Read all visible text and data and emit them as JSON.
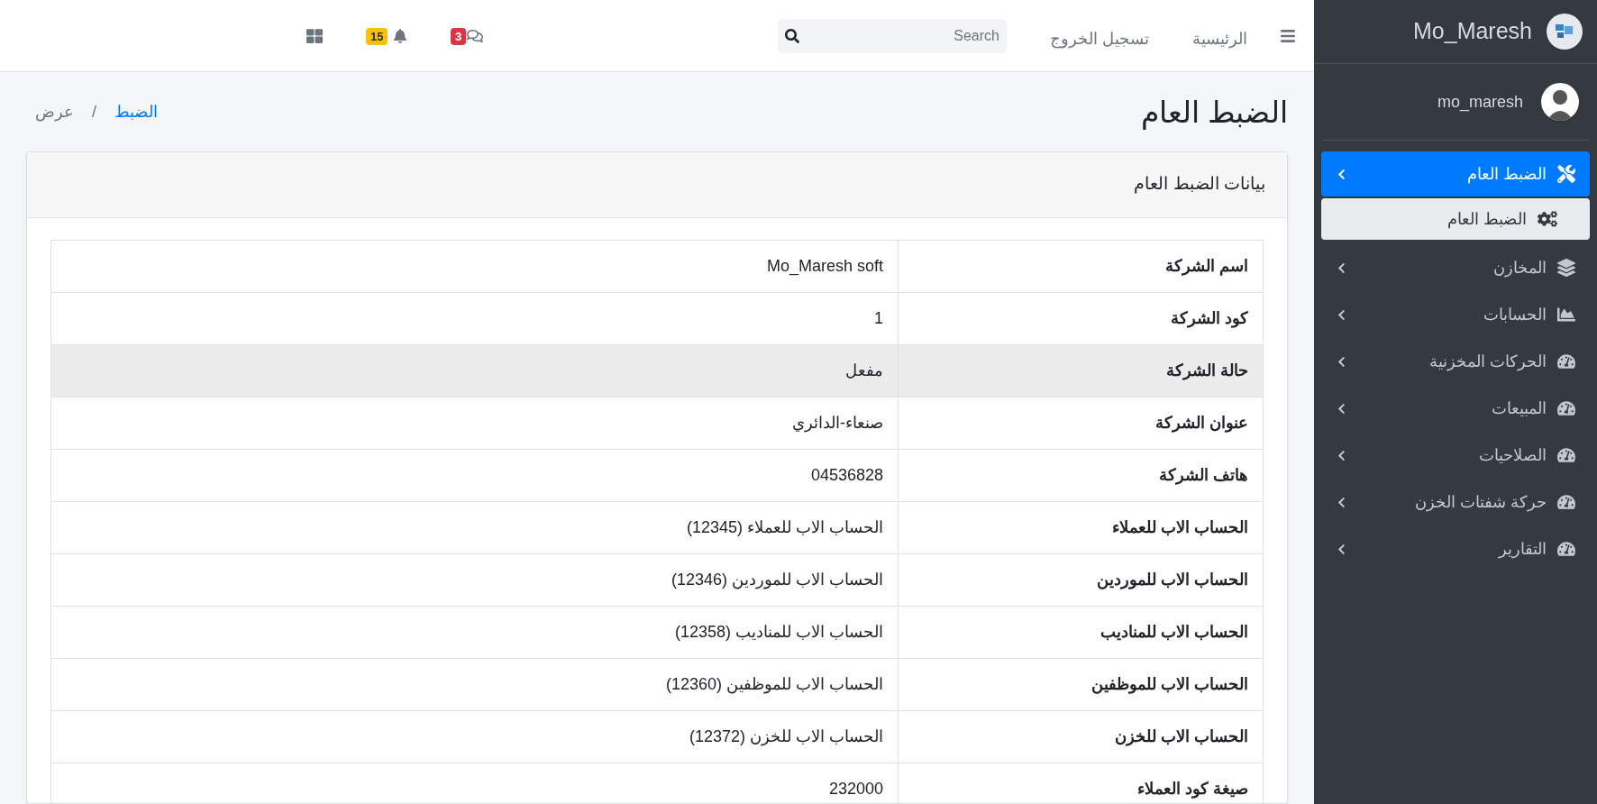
{
  "sidebar": {
    "brand": "Mo_Maresh",
    "user": "mo_maresh",
    "items": [
      {
        "label": "الضبط العام",
        "selected": true,
        "children": [
          {
            "label": "الضبط العام",
            "selected": true
          }
        ]
      },
      {
        "label": "المخازن",
        "selected": false
      },
      {
        "label": "الحسابات",
        "selected": false
      },
      {
        "label": "الحركات المخزنية",
        "selected": false
      },
      {
        "label": "المبيعات",
        "selected": false
      },
      {
        "label": "الصلاحيات",
        "selected": false
      },
      {
        "label": "حركة شفتات الخزن",
        "selected": false
      },
      {
        "label": "التقارير",
        "selected": false
      }
    ]
  },
  "navbar": {
    "links": [
      "الرئيسية",
      "تسجيل الخروج"
    ],
    "search": {
      "placeholder": "Search"
    },
    "messages_count": "3",
    "notifications_count": "15"
  },
  "page": {
    "title": "الضبط العام",
    "breadcrumb": {
      "separator": "/",
      "items": [
        {
          "label": "الضبط",
          "kind": "link"
        },
        {
          "label": "عرض",
          "kind": "active"
        }
      ]
    }
  },
  "card": {
    "title": "بيانات الضبط العام",
    "rows": [
      {
        "label": "اسم الشركة",
        "value": "Mo_Maresh soft",
        "selected": false
      },
      {
        "label": "كود الشركة",
        "value": "1",
        "selected": false
      },
      {
        "label": "حالة الشركة",
        "value": "مفعل",
        "selected": true
      },
      {
        "label": "عنوان الشركة",
        "value": "صنعاء-الدائري",
        "selected": false
      },
      {
        "label": "هاتف الشركة",
        "value": "04536828",
        "selected": false
      },
      {
        "label": "الحساب الاب للعملاء",
        "value": "الحساب الاب للعملاء (12345)",
        "selected": false
      },
      {
        "label": "الحساب الاب للموردين",
        "value": "الحساب الاب للموردين (12346)",
        "selected": false
      },
      {
        "label": "الحساب الاب للمناديب",
        "value": "الحساب الاب للمناديب (12358)",
        "selected": false
      },
      {
        "label": "الحساب الاب للموظفين",
        "value": "الحساب الاب للموظفين (12360)",
        "selected": false
      },
      {
        "label": "الحساب الاب للخزن",
        "value": "الحساب الاب للخزن (12372)",
        "selected": false
      },
      {
        "label": "صيغة كود العملاء",
        "value": "232000",
        "selected": false
      }
    ]
  }
}
